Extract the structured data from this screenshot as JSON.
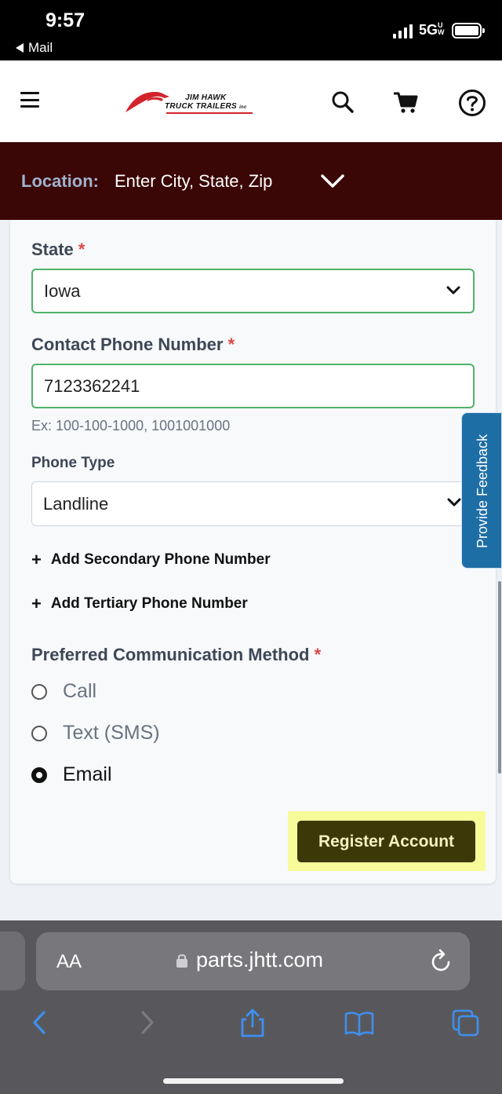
{
  "status_bar": {
    "time": "9:57",
    "back_app": "Mail",
    "network": "5G",
    "network_suffix": "UW",
    "icons": [
      "signal-icon",
      "battery-icon"
    ]
  },
  "header": {
    "logo_line1": "JIM HAWK",
    "logo_line2": "TRUCK TRAILERS",
    "logo_suffix": "inc",
    "icons": [
      "menu-icon",
      "search-icon",
      "cart-icon",
      "help-icon"
    ]
  },
  "location": {
    "label": "Location:",
    "placeholder": "Enter City, State, Zip"
  },
  "form": {
    "state": {
      "label": "State",
      "required_mark": "*",
      "value": "Iowa"
    },
    "contact_phone": {
      "label": "Contact Phone Number",
      "required_mark": "*",
      "value": "7123362241",
      "hint": "Ex: 100-100-1000, 1001001000"
    },
    "phone_type": {
      "label": "Phone Type",
      "value": "Landline"
    },
    "add_secondary": "Add Secondary Phone Number",
    "add_tertiary": "Add Tertiary Phone Number",
    "plus": "+",
    "communication": {
      "label": "Preferred Communication Method",
      "required_mark": "*",
      "options": [
        "Call",
        "Text (SMS)",
        "Email"
      ],
      "selected": "Email"
    },
    "submit_label": "Register Account"
  },
  "feedback_tab": "Provide Feedback",
  "browser": {
    "aa_label": "AA",
    "url": "parts.jhtt.com",
    "icons": [
      "lock-icon",
      "reload-icon",
      "back-icon",
      "forward-icon",
      "share-icon",
      "bookmarks-icon",
      "tabs-icon"
    ]
  },
  "colors": {
    "location_bg": "#3b0606",
    "location_label": "#9fb2cc",
    "valid_border": "#4fb26a",
    "required": "#e04848",
    "submit_bg": "#3d3808",
    "submit_highlight": "#f8fb9a",
    "feedback_bg": "#1e6ea6",
    "browser_bg": "#58585c",
    "ios_blue": "#3e8ff0"
  }
}
